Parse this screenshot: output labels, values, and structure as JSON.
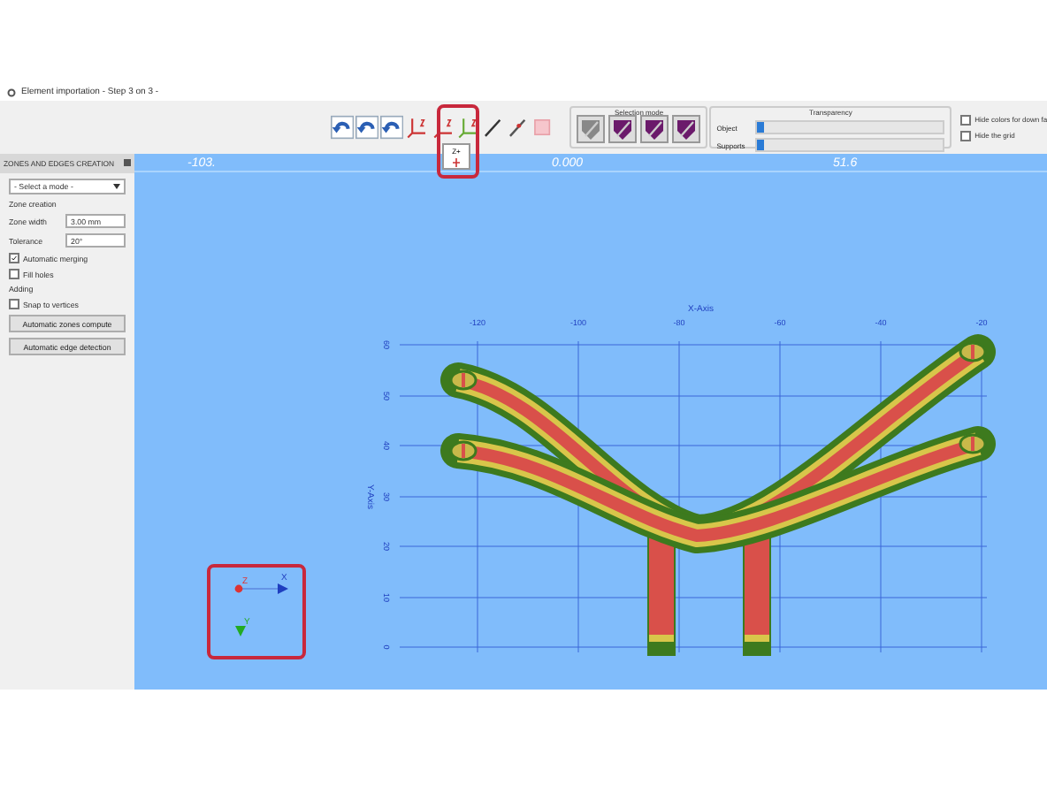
{
  "window": {
    "title": "Element importation - Step 3 on 3 -"
  },
  "toolbar": {
    "axis_menu": {
      "items": [
        "Z+"
      ]
    },
    "selection_mode": {
      "label": "Selection mode"
    },
    "transparency": {
      "label": "Transparency",
      "sliders": [
        {
          "name": "Object",
          "level": 0.04
        },
        {
          "name": "Supports",
          "level": 0.04
        }
      ]
    },
    "options": [
      {
        "label": "Hide colors for down fa",
        "checked": false
      },
      {
        "label": "Hide the grid",
        "checked": false
      }
    ]
  },
  "panel": {
    "title": "ZONES AND EDGES CREATION",
    "items": [
      {
        "kind": "dropdown",
        "value": "- Select a mode -"
      },
      {
        "kind": "heading",
        "label": "Zone creation"
      },
      {
        "kind": "spin",
        "label": "Zone width",
        "value": "3.00 mm"
      },
      {
        "kind": "spin",
        "label": "Tolerance",
        "value": "20°"
      },
      {
        "kind": "checkbox",
        "label": "Automatic merging",
        "checked": true
      },
      {
        "kind": "checkbox",
        "label": "Fill holes",
        "checked": false
      },
      {
        "kind": "heading",
        "label": "Adding"
      },
      {
        "kind": "checkbox",
        "label": "Snap to vertices",
        "checked": false
      },
      {
        "kind": "button",
        "label": "Automatic zones compute"
      },
      {
        "kind": "button",
        "label": "Automatic edge detection"
      }
    ]
  },
  "viewport": {
    "ruler": [
      "-103.",
      "0.000",
      "51.6"
    ],
    "x_axis_label": "X-Axis",
    "x_ticks": [
      "-120",
      "-100",
      "-80",
      "-60",
      "-40",
      "-20"
    ],
    "y_axis_label": "Y-Axis",
    "y_ticks": [
      "60",
      "50",
      "40",
      "30",
      "20",
      "10",
      "0"
    ],
    "gizmo": {
      "z": "Z",
      "x": "X",
      "y": "Y"
    }
  }
}
